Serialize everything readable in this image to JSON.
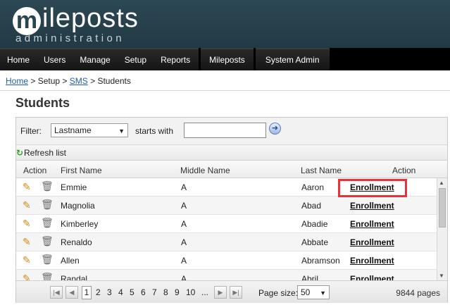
{
  "header": {
    "logo_mark": "m",
    "logo_text": "ileposts",
    "logo_sub": "administration"
  },
  "nav": {
    "group1": [
      "Home",
      "Users",
      "Manage",
      "Setup",
      "Reports"
    ],
    "mileposts": "Mileposts",
    "system_admin": "System Admin"
  },
  "breadcrumb": {
    "home": "Home",
    "sep1": " > ",
    "setup": "Setup",
    "sep2": " > ",
    "sms": "SMS",
    "sep3": " > ",
    "current": "Students"
  },
  "page_title": "Students",
  "filter": {
    "label": "Filter:",
    "field_value": "Lastname",
    "starts_with_label": "starts with",
    "search_value": "",
    "go_icon": "arrow-right-circle-icon"
  },
  "refresh": {
    "label": "Refresh list"
  },
  "grid": {
    "headers": {
      "action_left": "Action",
      "first_name": "First Name",
      "middle_name": "Middle Name",
      "last_name": "Last Name",
      "action_right": "Action"
    },
    "rows": [
      {
        "first": "Emmie",
        "middle": "A",
        "last": "Aaron",
        "action": "Enrollment"
      },
      {
        "first": "Magnolia",
        "middle": "A",
        "last": "Abad",
        "action": "Enrollment"
      },
      {
        "first": "Kimberley",
        "middle": "A",
        "last": "Abadie",
        "action": "Enrollment"
      },
      {
        "first": "Renaldo",
        "middle": "A",
        "last": "Abbate",
        "action": "Enrollment"
      },
      {
        "first": "Allen",
        "middle": "A",
        "last": "Abramson",
        "action": "Enrollment"
      },
      {
        "first": "Randal",
        "middle": "A",
        "last": "Abril",
        "action": "Enrollment"
      }
    ]
  },
  "pager": {
    "pages": [
      "1",
      "2",
      "3",
      "4",
      "5",
      "6",
      "7",
      "8",
      "9",
      "10",
      "..."
    ],
    "current_page": "1",
    "page_size_label": "Page size:",
    "page_size_value": "50",
    "page_count": "9844 pages"
  },
  "colors": {
    "header_bg": "#2c4754",
    "nav_bg": "#000000",
    "link": "#1f5fa8",
    "highlight": "#e8323a"
  }
}
